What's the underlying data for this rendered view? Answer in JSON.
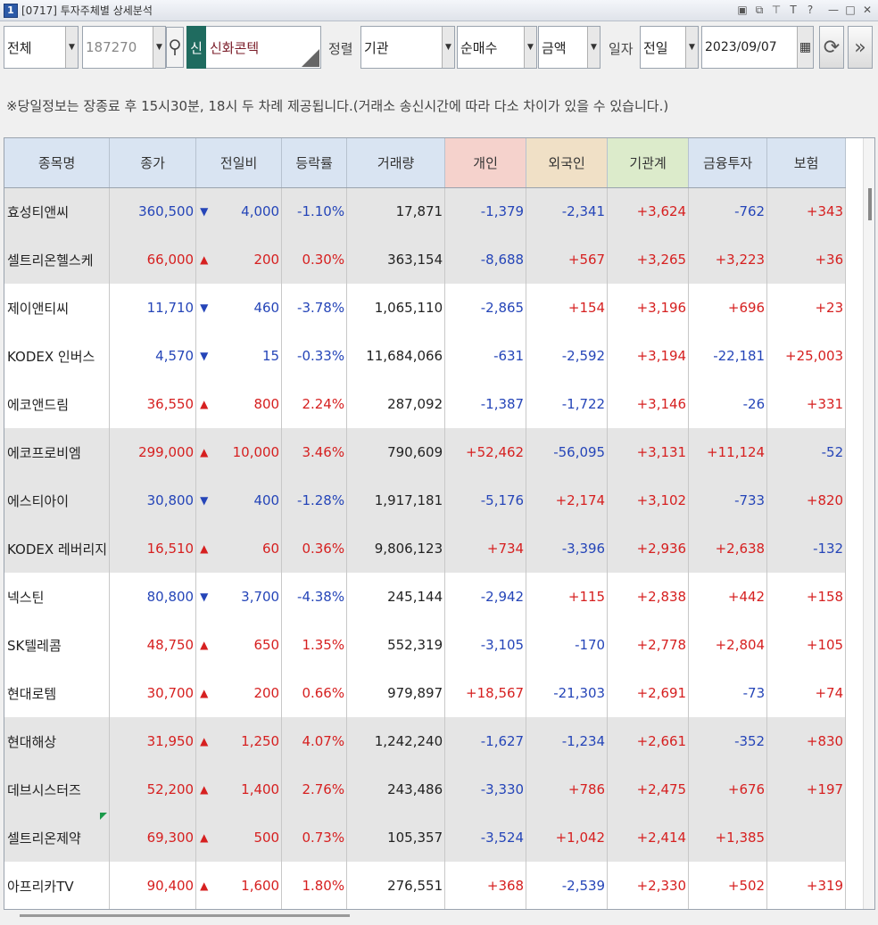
{
  "window": {
    "number": "1",
    "title": "[0717] 투자주체별 상세분석",
    "icons": [
      "layout-icon",
      "window-icon",
      "pin-icon",
      "font-icon",
      "help-icon",
      "minimize-icon",
      "maximize-icon",
      "close-icon"
    ],
    "icon_glyphs": [
      "▣",
      "⧉",
      "⊤",
      "T",
      "?",
      "—",
      "□",
      "✕"
    ]
  },
  "toolbar": {
    "market": "전체",
    "code": "187270",
    "shin_badge": "신",
    "stock_name": "신화콘텍",
    "sort_label": "정렬",
    "investor": "기관",
    "sort_by": "순매수",
    "unit": "금액",
    "date_label": "일자",
    "period": "전일",
    "date": "2023/09/07",
    "dd_glyph": "▼",
    "search_glyph": "🔍",
    "calendar_glyph": "▦",
    "refresh_glyph": "⟳",
    "next_glyph": "»"
  },
  "notice": "※당일정보는 장종료 후 15시30분, 18시 두 차례 제공됩니다.(거래소 송신시간에 따라 다소 차이가 있을 수 있습니다.)",
  "table": {
    "headers": [
      "종목명",
      "종가",
      "전일비",
      "등락률",
      "거래량",
      "개인",
      "외국인",
      "기관계",
      "금융투자",
      "보험"
    ],
    "rows": [
      {
        "name": "효성티앤씨",
        "close": "360,500",
        "dir": "down",
        "change": "4,000",
        "rate": "-1.10%",
        "volume": "17,871",
        "indiv": "-1,379",
        "foreign": "-2,341",
        "inst": "+3,624",
        "fin": "-762",
        "ins": "+343",
        "shade": "gray"
      },
      {
        "name": "셀트리온헬스케",
        "close": "66,000",
        "dir": "up",
        "change": "200",
        "rate": "0.30%",
        "volume": "363,154",
        "indiv": "-8,688",
        "foreign": "+567",
        "inst": "+3,265",
        "fin": "+3,223",
        "ins": "+36",
        "shade": "gray"
      },
      {
        "name": "제이앤티씨",
        "close": "11,710",
        "dir": "down",
        "change": "460",
        "rate": "-3.78%",
        "volume": "1,065,110",
        "indiv": "-2,865",
        "foreign": "+154",
        "inst": "+3,196",
        "fin": "+696",
        "ins": "+23",
        "shade": "white"
      },
      {
        "name": "KODEX 인버스",
        "close": "4,570",
        "dir": "down",
        "change": "15",
        "rate": "-0.33%",
        "volume": "11,684,066",
        "indiv": "-631",
        "foreign": "-2,592",
        "inst": "+3,194",
        "fin": "-22,181",
        "ins": "+25,003",
        "shade": "white"
      },
      {
        "name": "에코앤드림",
        "close": "36,550",
        "dir": "up",
        "change": "800",
        "rate": "2.24%",
        "volume": "287,092",
        "indiv": "-1,387",
        "foreign": "-1,722",
        "inst": "+3,146",
        "fin": "-26",
        "ins": "+331",
        "shade": "white"
      },
      {
        "name": "에코프로비엠",
        "close": "299,000",
        "dir": "up",
        "change": "10,000",
        "rate": "3.46%",
        "volume": "790,609",
        "indiv": "+52,462",
        "foreign": "-56,095",
        "inst": "+3,131",
        "fin": "+11,124",
        "ins": "-52",
        "shade": "gray"
      },
      {
        "name": "에스티아이",
        "close": "30,800",
        "dir": "down",
        "change": "400",
        "rate": "-1.28%",
        "volume": "1,917,181",
        "indiv": "-5,176",
        "foreign": "+2,174",
        "inst": "+3,102",
        "fin": "-733",
        "ins": "+820",
        "shade": "gray"
      },
      {
        "name": "KODEX 레버리지",
        "close": "16,510",
        "dir": "up",
        "change": "60",
        "rate": "0.36%",
        "volume": "9,806,123",
        "indiv": "+734",
        "foreign": "-3,396",
        "inst": "+2,936",
        "fin": "+2,638",
        "ins": "-132",
        "shade": "gray"
      },
      {
        "name": "넥스틴",
        "close": "80,800",
        "dir": "down",
        "change": "3,700",
        "rate": "-4.38%",
        "volume": "245,144",
        "indiv": "-2,942",
        "foreign": "+115",
        "inst": "+2,838",
        "fin": "+442",
        "ins": "+158",
        "shade": "white"
      },
      {
        "name": "SK텔레콤",
        "close": "48,750",
        "dir": "up",
        "change": "650",
        "rate": "1.35%",
        "volume": "552,319",
        "indiv": "-3,105",
        "foreign": "-170",
        "inst": "+2,778",
        "fin": "+2,804",
        "ins": "+105",
        "shade": "white"
      },
      {
        "name": "현대로템",
        "close": "30,700",
        "dir": "up",
        "change": "200",
        "rate": "0.66%",
        "volume": "979,897",
        "indiv": "+18,567",
        "foreign": "-21,303",
        "inst": "+2,691",
        "fin": "-73",
        "ins": "+74",
        "shade": "white"
      },
      {
        "name": "현대해상",
        "close": "31,950",
        "dir": "up",
        "change": "1,250",
        "rate": "4.07%",
        "volume": "1,242,240",
        "indiv": "-1,627",
        "foreign": "-1,234",
        "inst": "+2,661",
        "fin": "-352",
        "ins": "+830",
        "shade": "gray"
      },
      {
        "name": "데브시스터즈",
        "close": "52,200",
        "dir": "up",
        "change": "1,400",
        "rate": "2.76%",
        "volume": "243,486",
        "indiv": "-3,330",
        "foreign": "+786",
        "inst": "+2,475",
        "fin": "+676",
        "ins": "+197",
        "shade": "gray"
      },
      {
        "name": "셀트리온제약",
        "close": "69,300",
        "dir": "up",
        "change": "500",
        "rate": "0.73%",
        "volume": "105,357",
        "indiv": "-3,524",
        "foreign": "+1,042",
        "inst": "+2,414",
        "fin": "+1,385",
        "ins": "",
        "shade": "gray"
      },
      {
        "name": "아프리카TV",
        "close": "90,400",
        "dir": "up",
        "change": "1,600",
        "rate": "1.80%",
        "volume": "276,551",
        "indiv": "+368",
        "foreign": "-2,539",
        "inst": "+2,330",
        "fin": "+502",
        "ins": "+319",
        "shade": "white"
      }
    ]
  },
  "colors": {
    "up": "#d62020",
    "down": "#2545b8",
    "header": "#d9e4f2",
    "header_individual": "#f5d2cc",
    "header_foreign": "#f0e0c6",
    "header_institution": "#dcebcb"
  }
}
